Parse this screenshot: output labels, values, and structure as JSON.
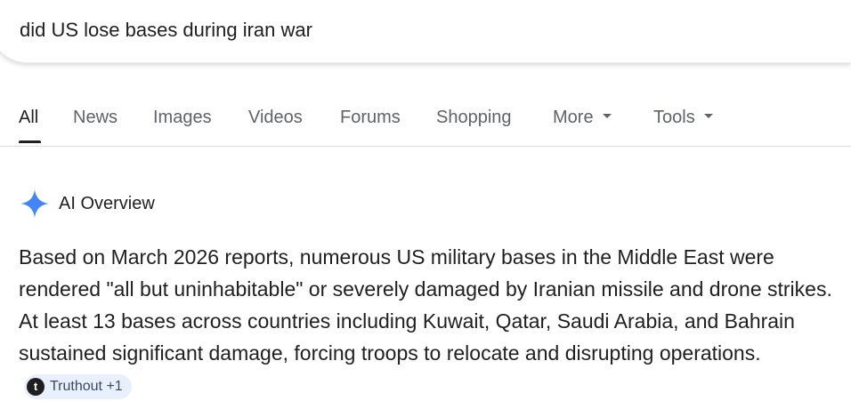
{
  "search": {
    "query": "did US lose bases during iran war"
  },
  "tabs": [
    {
      "label": "All",
      "active": true
    },
    {
      "label": "News"
    },
    {
      "label": "Images"
    },
    {
      "label": "Videos"
    },
    {
      "label": "Forums"
    },
    {
      "label": "Shopping"
    },
    {
      "label": "More",
      "has_dropdown": true
    },
    {
      "label": "Tools",
      "has_dropdown": true
    }
  ],
  "ai_overview": {
    "icon": "sparkle-icon",
    "icon_color": "#4285f4",
    "title": "AI Overview",
    "body": "Based on March 2026 reports, numerous US military bases in the Middle East were rendered \"all but uninhabitable\" or severely damaged by Iranian missile and drone strikes. At least 13 bases across countries including Kuwait, Qatar, Saudi Arabia, and Bahrain sustained significant damage, forcing troops to relocate and disrupting operations.",
    "source_chip": {
      "logo_letter": "t",
      "label": "Truthout +1",
      "background": "#e8f0fe"
    }
  }
}
